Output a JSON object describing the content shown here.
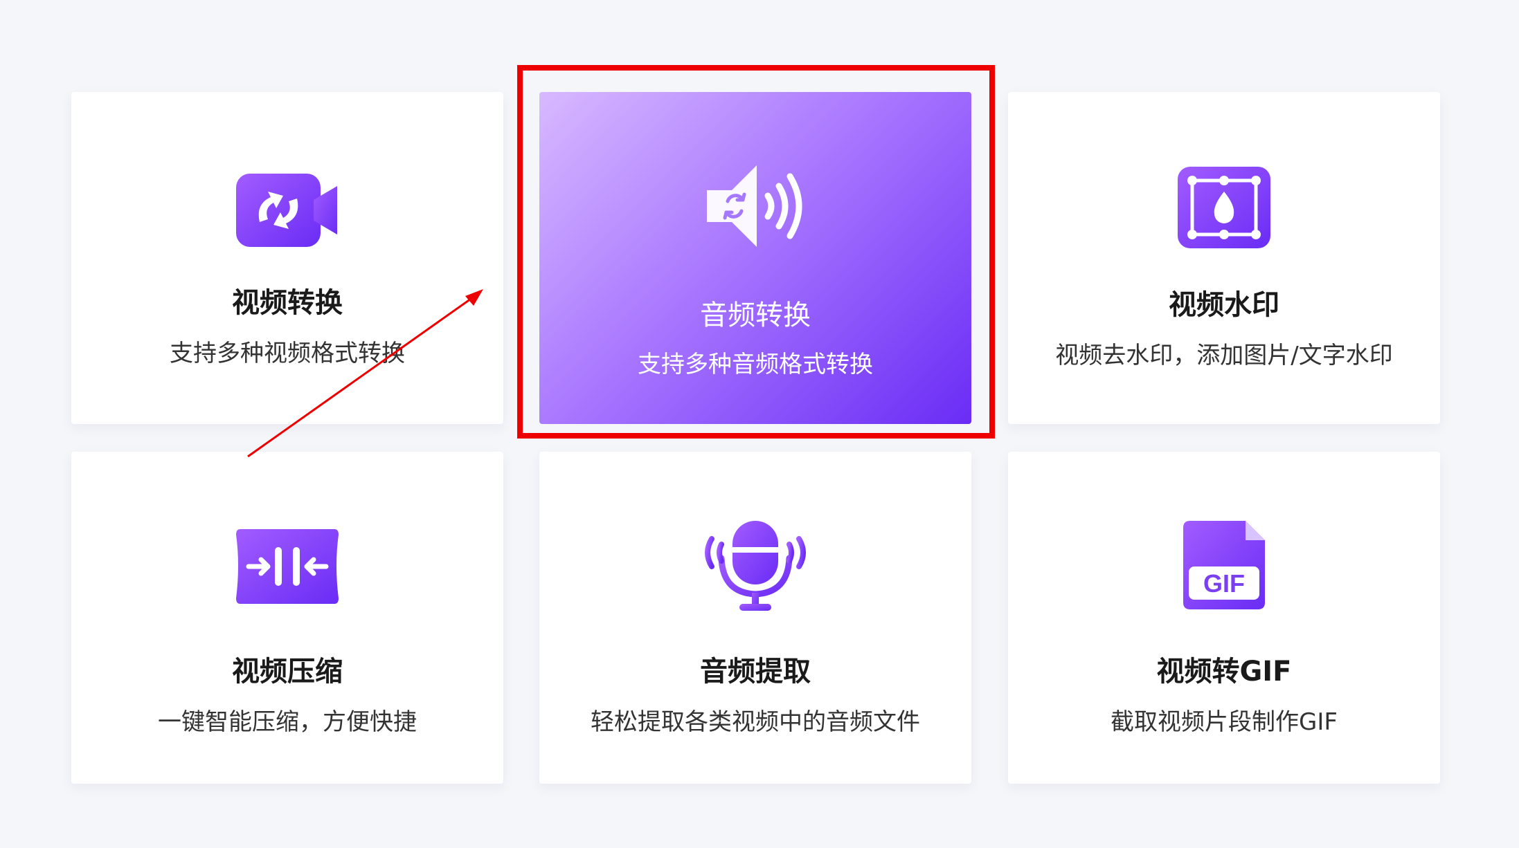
{
  "cards": [
    {
      "title": "视频转换",
      "desc": "支持多种视频格式转换",
      "icon": "video-convert-icon"
    },
    {
      "title": "音频转换",
      "desc": "支持多种音频格式转换",
      "icon": "audio-convert-icon",
      "active": true
    },
    {
      "title": "视频水印",
      "desc": "视频去水印，添加图片/文字水印",
      "icon": "video-watermark-icon"
    },
    {
      "title": "视频压缩",
      "desc": "一键智能压缩，方便快捷",
      "icon": "video-compress-icon"
    },
    {
      "title": "音频提取",
      "desc": "轻松提取各类视频中的音频文件",
      "icon": "audio-extract-icon"
    },
    {
      "title": "视频转GIF",
      "desc": "截取视频片段制作GIF",
      "icon": "gif-icon",
      "icon_text": "GIF"
    }
  ],
  "colors": {
    "accent": "#7b3ff2",
    "highlight": "#ee0000",
    "background": "#f5f6fa"
  }
}
